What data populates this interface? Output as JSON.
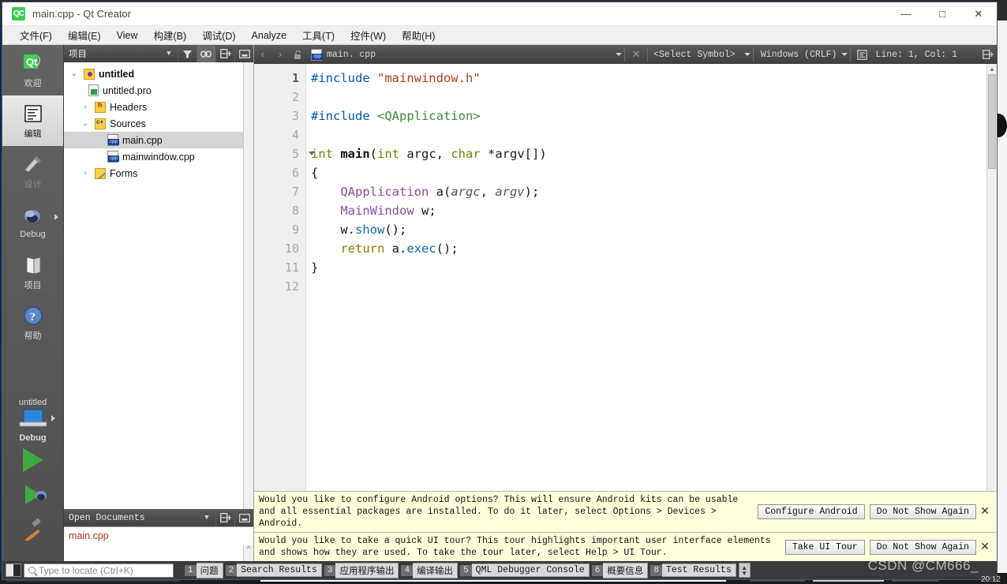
{
  "window": {
    "title": "main.cpp - Qt Creator",
    "app_badge": "QC",
    "minimize": "—",
    "maximize": "□",
    "close": "✕"
  },
  "menubar": {
    "items": [
      {
        "label": "文件(F)",
        "name": "menu-file"
      },
      {
        "label": "编辑(E)",
        "name": "menu-edit"
      },
      {
        "label": "View",
        "name": "menu-view"
      },
      {
        "label": "构建(B)",
        "name": "menu-build"
      },
      {
        "label": "调试(D)",
        "name": "menu-debug"
      },
      {
        "label": "Analyze",
        "name": "menu-analyze"
      },
      {
        "label": "工具(T)",
        "name": "menu-tools"
      },
      {
        "label": "控件(W)",
        "name": "menu-widgets"
      },
      {
        "label": "帮助(H)",
        "name": "menu-help"
      }
    ]
  },
  "modebar": {
    "modes": [
      {
        "label": "欢迎",
        "icon": "qt-logo-icon",
        "state": "normal"
      },
      {
        "label": "编辑",
        "icon": "editor-icon",
        "state": "selected"
      },
      {
        "label": "设计",
        "icon": "design-brush-icon",
        "state": "disabled"
      },
      {
        "label": "Debug",
        "icon": "bug-icon",
        "state": "normal"
      },
      {
        "label": "项目",
        "icon": "projects-book-icon",
        "state": "normal"
      },
      {
        "label": "帮助",
        "icon": "help-question-icon",
        "state": "normal"
      }
    ],
    "kit": {
      "project": "untitled",
      "build_config": "Debug",
      "run_label": "run-button",
      "debug_label": "start-debugging-button",
      "build_label": "build-project-button"
    }
  },
  "project_panel": {
    "title": "项目",
    "icons": [
      "filter-icon",
      "link-sync-icon",
      "split-icon",
      "minimize-icon"
    ],
    "tree": [
      {
        "label": "untitled",
        "indent": 0,
        "twist": "v",
        "icon": "project-icon",
        "bold": true,
        "selected": false
      },
      {
        "label": "untitled.pro",
        "indent": 1,
        "twist": "",
        "icon": "pro-file-icon",
        "bold": false,
        "selected": false
      },
      {
        "label": "Headers",
        "indent": 1,
        "twist": ">",
        "icon": "headers-folder-icon",
        "bold": false,
        "selected": false
      },
      {
        "label": "Sources",
        "indent": 1,
        "twist": "v",
        "icon": "sources-folder-icon",
        "bold": false,
        "selected": false
      },
      {
        "label": "main.cpp",
        "indent": 2,
        "twist": "",
        "icon": "cpp-file-icon",
        "bold": false,
        "selected": true
      },
      {
        "label": "mainwindow.cpp",
        "indent": 2,
        "twist": "",
        "icon": "cpp-file-icon",
        "bold": false,
        "selected": false
      },
      {
        "label": "Forms",
        "indent": 1,
        "twist": ">",
        "icon": "forms-folder-icon",
        "bold": false,
        "selected": false
      }
    ]
  },
  "open_documents": {
    "title": "Open Documents",
    "icons": [
      "split-icon",
      "minimize-icon"
    ],
    "files": [
      "main.cpp"
    ]
  },
  "editor_toolbar": {
    "back": "‹",
    "forward": "›",
    "lock": "lock-icon",
    "filename": "main. cpp",
    "close": "✕",
    "symbol_selector": "<Select Symbol>",
    "line_ending": "Windows (CRLF)",
    "cursor_position": "Line: 1, Col: 1",
    "split_icon": "split-icon"
  },
  "code": {
    "lines": [
      {
        "n": "1",
        "fold": false,
        "current": true
      },
      {
        "n": "2",
        "fold": false,
        "current": false
      },
      {
        "n": "3",
        "fold": false,
        "current": false
      },
      {
        "n": "4",
        "fold": false,
        "current": false
      },
      {
        "n": "5",
        "fold": true,
        "current": false
      },
      {
        "n": "6",
        "fold": false,
        "current": false
      },
      {
        "n": "7",
        "fold": false,
        "current": false
      },
      {
        "n": "8",
        "fold": false,
        "current": false
      },
      {
        "n": "9",
        "fold": false,
        "current": false
      },
      {
        "n": "10",
        "fold": false,
        "current": false
      },
      {
        "n": "11",
        "fold": false,
        "current": false
      },
      {
        "n": "12",
        "fold": false,
        "current": false
      }
    ],
    "text": [
      "#include \"mainwindow.h\"",
      "",
      "#include <QApplication>",
      "",
      "int main(int argc, char *argv[])",
      "{",
      "    QApplication a(argc, argv);",
      "    MainWindow w;",
      "    w.show();",
      "    return a.exec();",
      "}",
      ""
    ],
    "tokens": {
      "l1_pre": "#include",
      "l1_str": " \"mainwindow.h\"",
      "l3_pre": "#include",
      "l3_inc": " <QApplication>",
      "l5_int": "int ",
      "l5_main": "main",
      "l5_p1": "(",
      "l5_int2": "int",
      "l5_argc": " argc",
      "l5_comma": ", ",
      "l5_char": "char",
      "l5_argv": " *argv[])",
      "l6": "{",
      "l7_type": "    QApplication",
      "l7_a": " a(",
      "l7_argc": "argc",
      "l7_c": ", ",
      "l7_argv": "argv",
      "l7_end": ");",
      "l8_type": "    MainWindow",
      "l8_w": " w;",
      "l9_w": "    w.",
      "l9_show": "show",
      "l9_end": "();",
      "l10_ret": "    return ",
      "l10_a": "a.",
      "l10_exec": "exec",
      "l10_end": "();",
      "l11": "}"
    }
  },
  "infobars": [
    {
      "text": "Would you like to configure Android options? This will ensure Android kits can be usable and all essential packages are installed.  To do it later, select Options > Devices > Android.",
      "primary_button": "Configure Android",
      "secondary_button": "Do Not Show Again",
      "close": "✕"
    },
    {
      "text": "Would you like to take a quick UI tour? This tour highlights important user interface elements and shows how they are used. To take the tour later, select Help > UI Tour.",
      "primary_button": "Take UI Tour",
      "secondary_button": "Do Not Show Again",
      "close": "✕"
    }
  ],
  "statusbar": {
    "sidebar_toggle": "toggle-sidebar-icon",
    "locator_placeholder": "Type to locate (Ctrl+K)",
    "output_tabs": [
      {
        "num": "1",
        "label": "问题"
      },
      {
        "num": "2",
        "label": "Search Results"
      },
      {
        "num": "3",
        "label": "应用程序输出"
      },
      {
        "num": "4",
        "label": "编译输出"
      },
      {
        "num": "5",
        "label": "QML Debugger Console"
      },
      {
        "num": "6",
        "label": "概要信息"
      },
      {
        "num": "8",
        "label": "Test Results"
      }
    ],
    "spinner": "up-down-icon"
  },
  "overlay": {
    "watermark": "CSDN @CM666_",
    "clock": "20:12"
  }
}
